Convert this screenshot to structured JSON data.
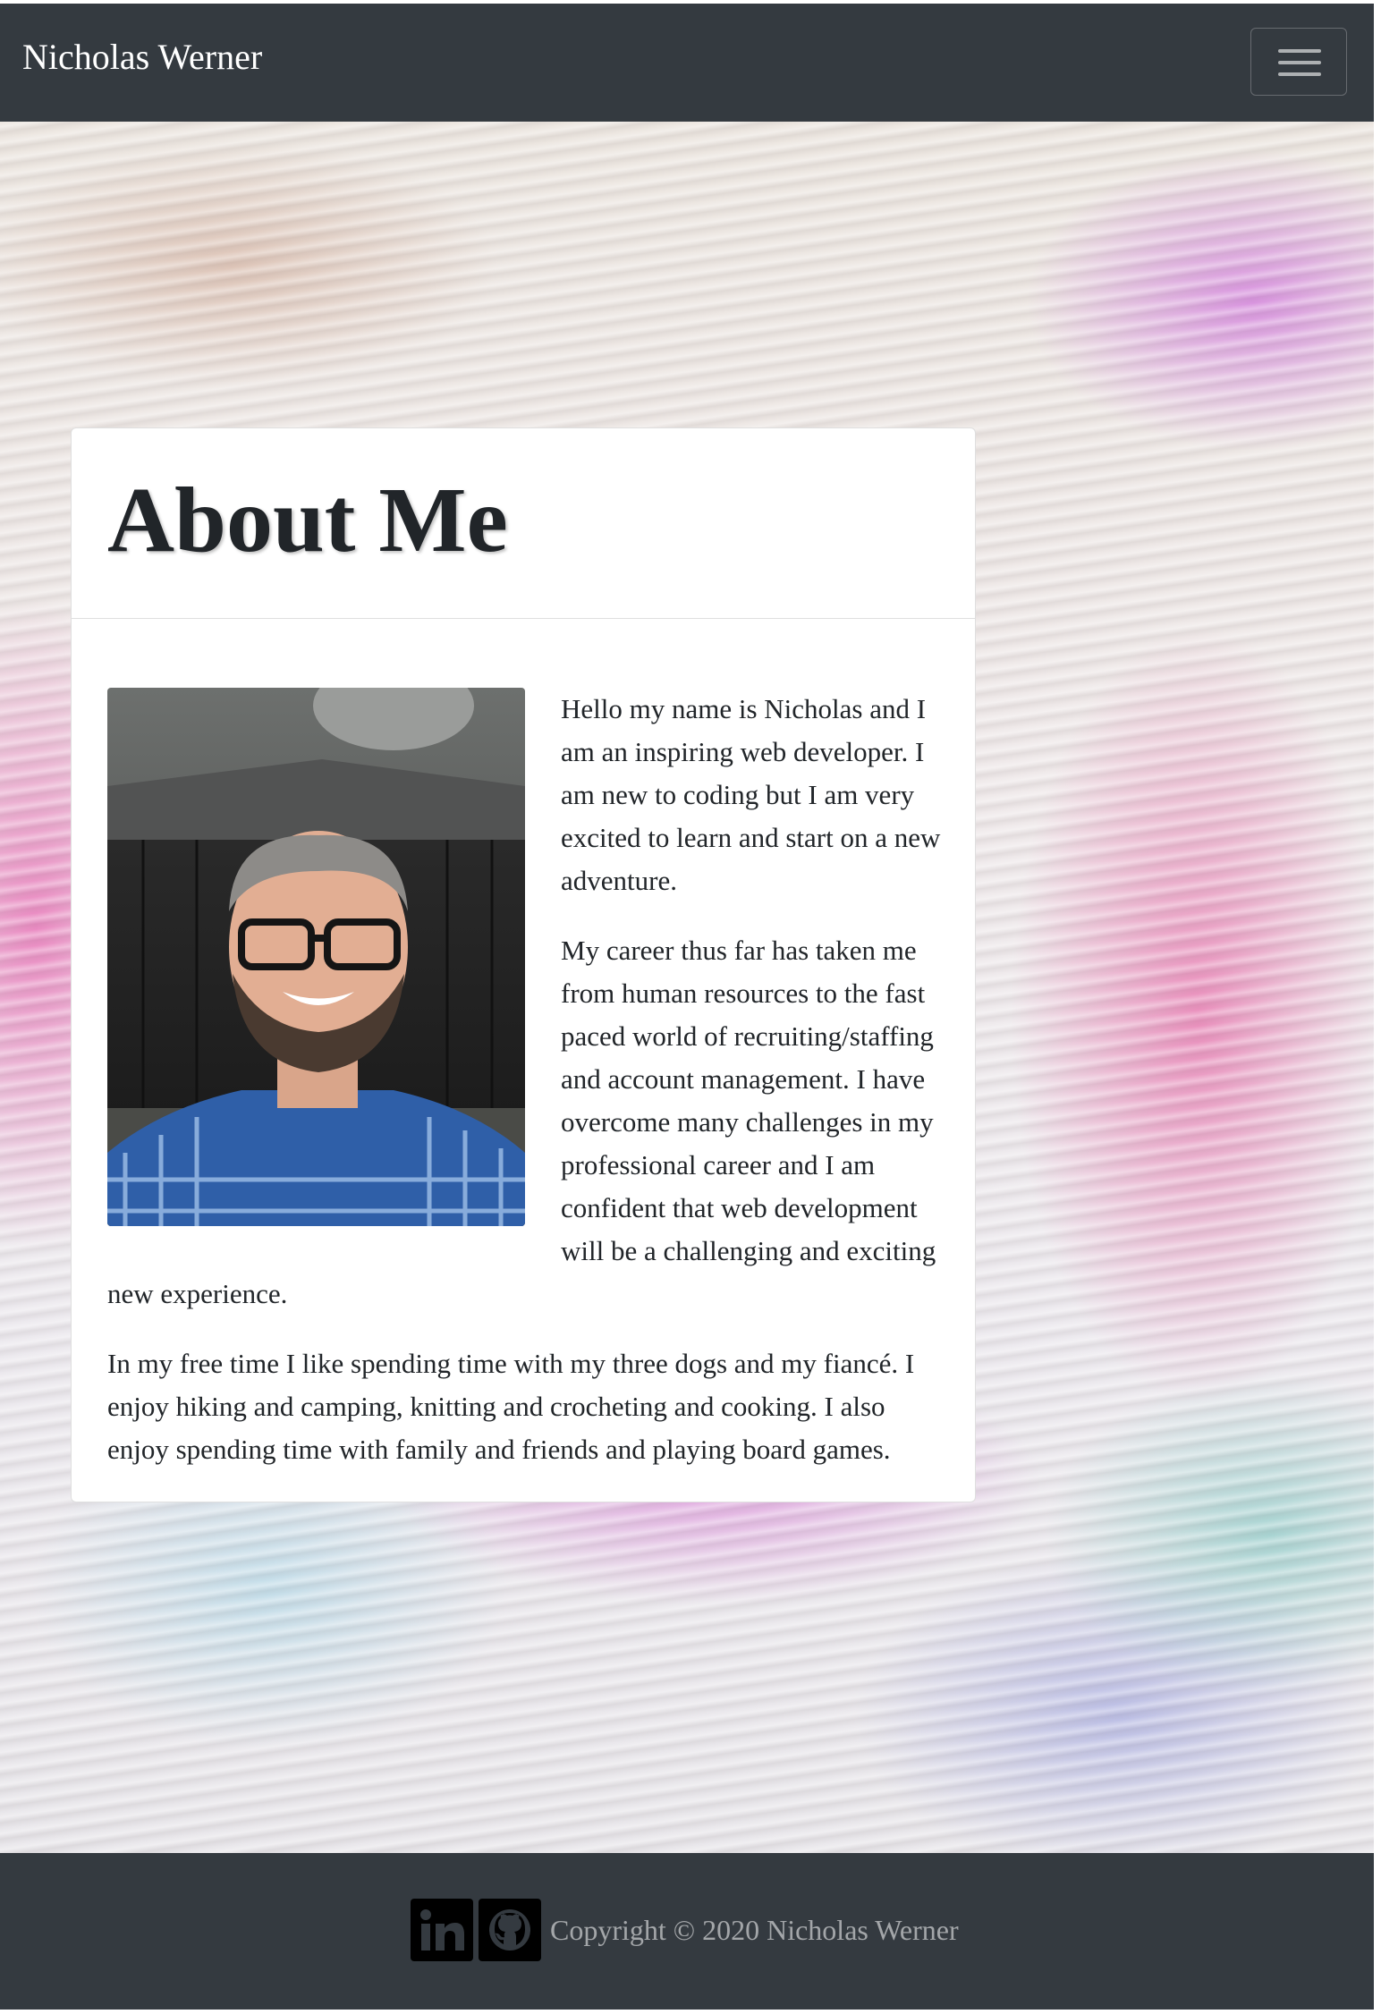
{
  "navbar": {
    "brand": "Nicholas Werner",
    "toggle_icon": "hamburger-menu-icon"
  },
  "about": {
    "title": "About Me",
    "photo_icon": "profile-photo",
    "paragraphs": [
      "Hello my name is Nicholas and I am an inspiring web developer. I am new to coding but I am very excited to learn and start on a new adventure.",
      "My career thus far has taken me from human resources to the fast paced world of recruiting/staffing and account management. I have overcome many challenges in my professional career and I am confident that web development will be a challenging and exciting new experience.",
      "In my free time I like spending time with my three dogs and my fiancé. I enjoy hiking and camping, knitting and crocheting and cooking. I also enjoy spending time with family and friends and playing board games."
    ]
  },
  "footer": {
    "linkedin_icon": "linkedin-icon",
    "github_icon": "github-icon",
    "copyright": "Copyright © 2020 Nicholas Werner"
  },
  "colors": {
    "navbar_bg": "#343a40",
    "footer_bg": "#343a40",
    "card_bg": "#ffffff",
    "text": "#212529"
  }
}
